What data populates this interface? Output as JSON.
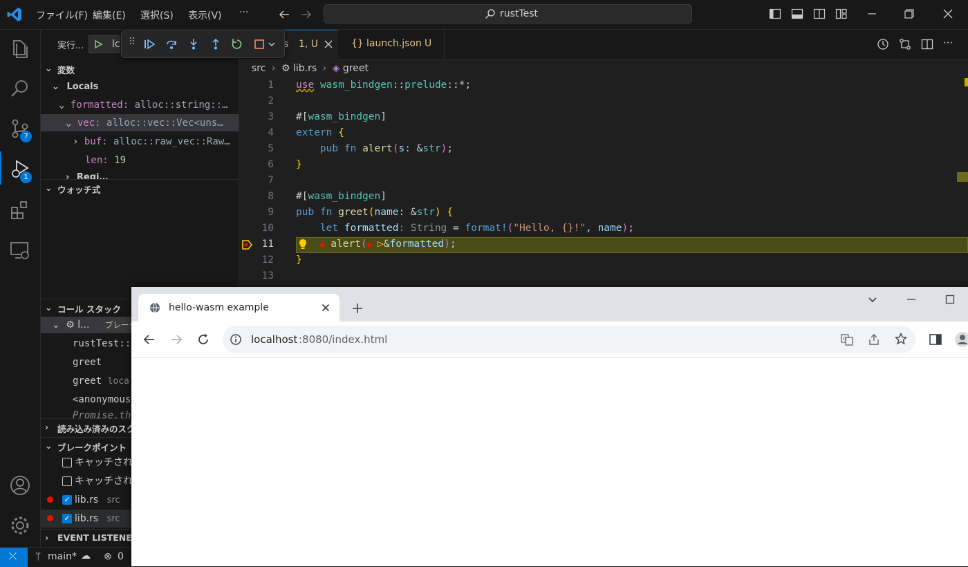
{
  "titlebar": {
    "menus": [
      "ファイル(F)",
      "編集(E)",
      "選択(S)",
      "表示(V)"
    ],
    "more": "···",
    "search_text": "rustTest"
  },
  "activity": {
    "scm_badge": "7",
    "debug_badge": "1"
  },
  "debug_toolbar": {
    "run_label": "実行...",
    "config_label": "lc"
  },
  "tabs": [
    {
      "label": "s",
      "status": "1, U"
    },
    {
      "label": "launch.json",
      "status": "U"
    }
  ],
  "breadcrumb": [
    "src",
    "lib.rs",
    "greet"
  ],
  "variables": {
    "header": "変数",
    "locals_label": "Locals",
    "rows": [
      {
        "name": "formatted:",
        "value": "alloc::string::…"
      },
      {
        "name": "vec:",
        "value": "alloc::vec::Vec<uns…"
      },
      {
        "name": "buf:",
        "value": "alloc::raw_vec::Raw…"
      },
      {
        "name": "len:",
        "value": "19"
      }
    ],
    "partial_row": "Regi…"
  },
  "watch": {
    "header": "ウォッチ式"
  },
  "callstack": {
    "header": "コール スタック",
    "thread_label": "l...",
    "thread_status": "ブレーク",
    "frames": [
      {
        "name": "rustTest::",
        "detail": ""
      },
      {
        "name": "greet",
        "detail": ""
      },
      {
        "name": "greet",
        "detail": "loca"
      },
      {
        "name": "<anonymous",
        "detail": ""
      }
    ],
    "promise_row": "Promise.th"
  },
  "loaded_scripts": {
    "header": "読み込み済みのスク"
  },
  "breakpoints": {
    "header": "ブレークポイント",
    "items": [
      {
        "label": "キャッチされた",
        "checked": false,
        "file": "",
        "dot": false
      },
      {
        "label": "キャッチされな",
        "checked": false,
        "file": "",
        "dot": false
      },
      {
        "label": "lib.rs",
        "checked": true,
        "file": "src",
        "dot": true
      },
      {
        "label": "lib.rs",
        "checked": true,
        "file": "src",
        "dot": true
      }
    ]
  },
  "event_listener": {
    "header": "EVENT LISTENER"
  },
  "editor": {
    "line_numbers": [
      "1",
      "2",
      "3",
      "4",
      "5",
      "6",
      "7",
      "8",
      "9",
      "10",
      "11",
      "12",
      "13"
    ],
    "current_line": "11"
  },
  "statusbar": {
    "branch": "main*",
    "errors": "0"
  },
  "browser": {
    "tab_title": "hello-wasm example",
    "url_host": "localhost",
    "url_rest": ":8080/index.html"
  },
  "colors": {
    "accent": "#0078d4",
    "breakpoint": "#e51400",
    "current_line_bg": "#4b4b18",
    "debug_arrow": "#ffcc00"
  }
}
